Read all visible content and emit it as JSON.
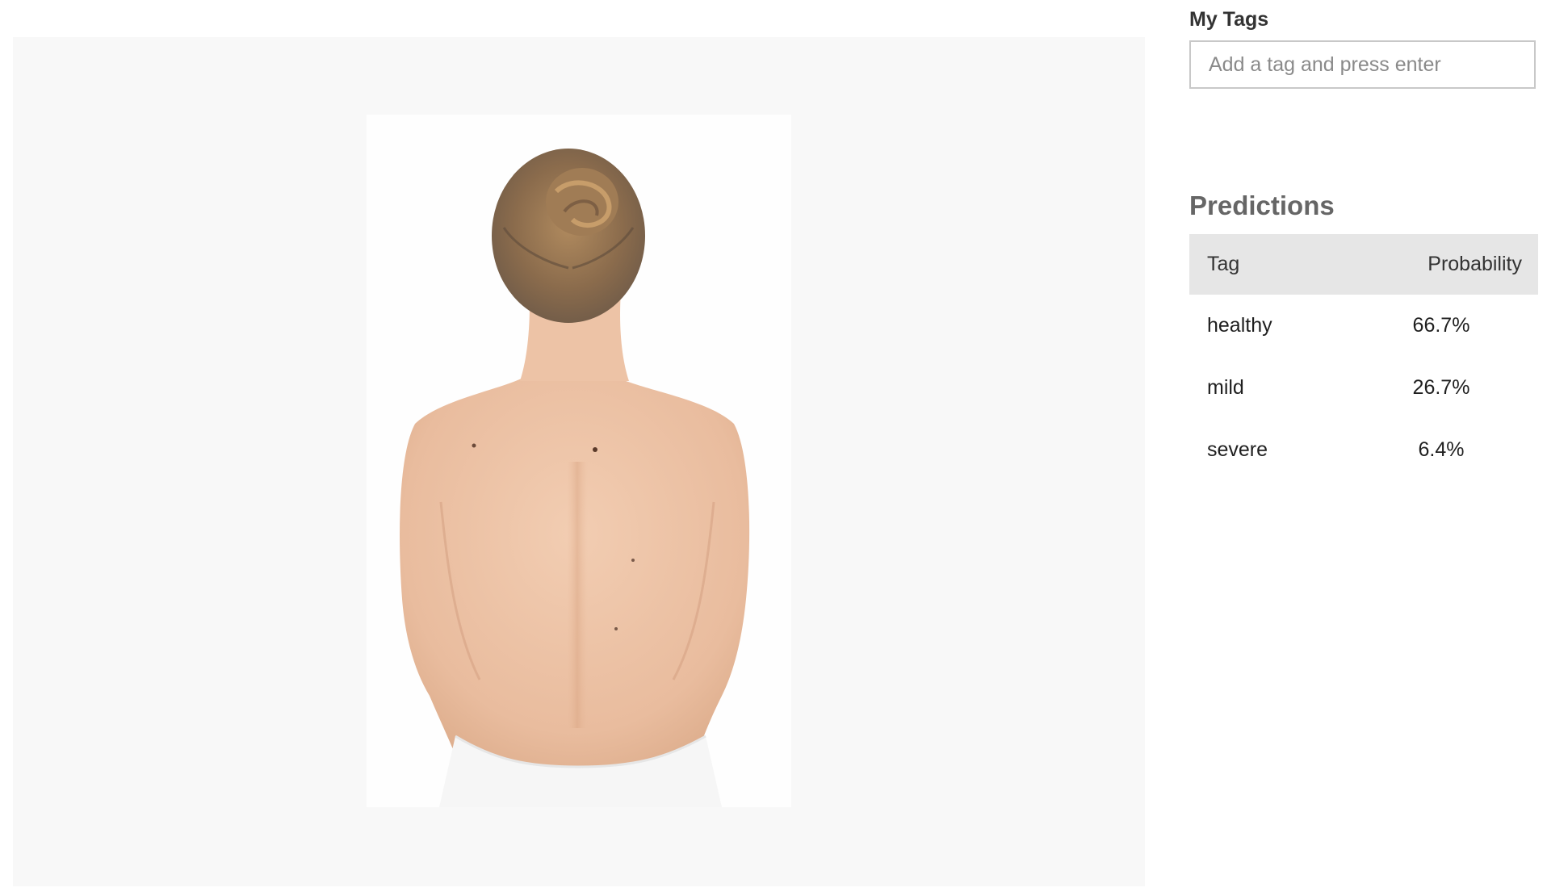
{
  "image": {
    "alt_icon": "photo-back-view"
  },
  "my_tags": {
    "title": "My Tags",
    "input_placeholder": "Add a tag and press enter",
    "input_value": ""
  },
  "predictions": {
    "title": "Predictions",
    "columns": [
      "Tag",
      "Probability"
    ],
    "rows": [
      {
        "tag": "healthy",
        "probability": "66.7%"
      },
      {
        "tag": "mild",
        "probability": "26.7%"
      },
      {
        "tag": "severe",
        "probability": "6.4%"
      }
    ]
  }
}
